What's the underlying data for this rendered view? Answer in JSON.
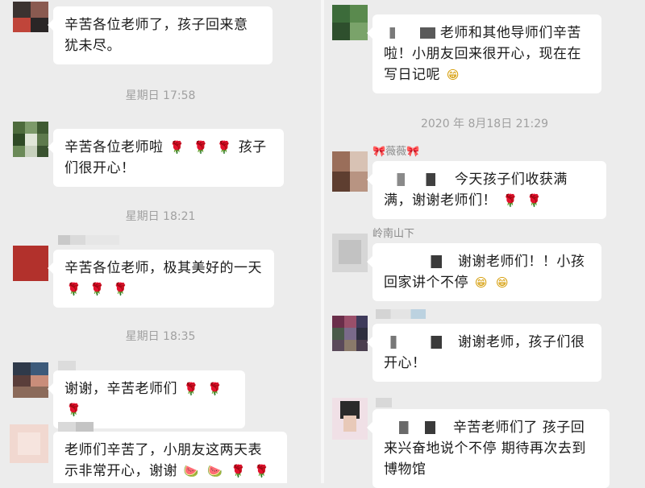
{
  "left": {
    "messages": [
      {
        "text": "辛苦各位老师了，孩子回来意犹未尽。"
      },
      {
        "text": "辛苦各位老师啦",
        "emoji_suffix": [
          "🌹",
          "🌹",
          "🌹"
        ],
        "text2": "孩子们很开心！"
      },
      {
        "text": "辛苦各位老师，极其美好的一天",
        "emoji_suffix": [
          "🌹",
          "🌹",
          "🌹"
        ]
      },
      {
        "text": "谢谢，辛苦老师们",
        "emoji_suffix": [
          "🌹",
          "🌹",
          "🌹"
        ]
      },
      {
        "text": "老师们辛苦了，小朋友这两天表示非常开心，谢谢",
        "emoji_suffix": [
          "🍉",
          "🍉",
          "🌹",
          "🌹"
        ]
      }
    ],
    "timestamps": [
      "星期日 17:58",
      "星期日 18:21",
      "星期日 18:35"
    ]
  },
  "right": {
    "messages": [
      {
        "text": "老师和其他导师们辛苦啦！小朋友回来很开心，现在在写日记呢",
        "emoji_suffix": [
          "😁"
        ]
      },
      {
        "text": "今天孩子们收获满满，谢谢老师们！",
        "emoji_suffix": [
          "🌹",
          "🌹"
        ]
      },
      {
        "text": "谢谢老师们！！小孩回家讲个不停",
        "emoji_suffix": [
          "😁",
          "😁"
        ]
      },
      {
        "text": "谢谢老师，孩子们很开心！"
      },
      {
        "text": "辛苦老师们了 孩子回来兴奋地说个不停 期待再次去到博物馆"
      }
    ],
    "timestamps": [
      "2020 年 8月18日 21:29"
    ],
    "names": [
      "🎀薇薇🎀",
      "岭南山下"
    ]
  },
  "colors": {
    "background": "#ececec",
    "bubble": "#ffffff",
    "timestamp": "#a0a0a0",
    "name": "#8a8a8a"
  }
}
